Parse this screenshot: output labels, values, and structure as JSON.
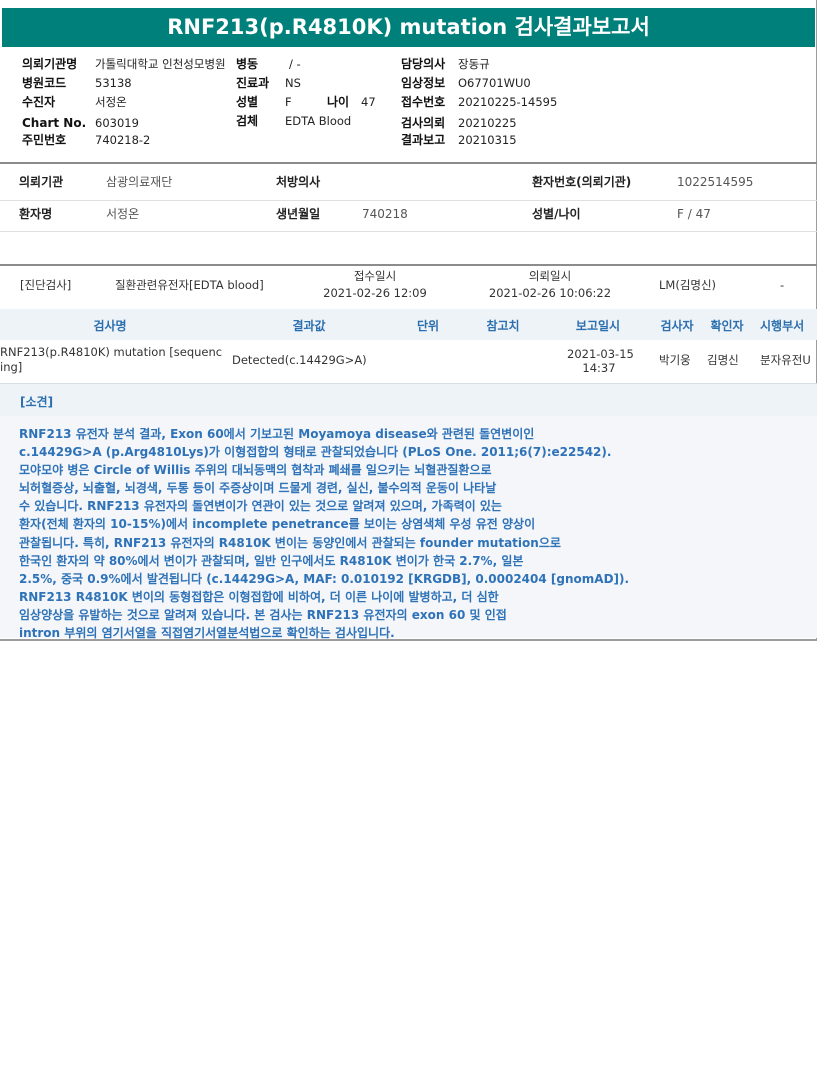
{
  "title": "RNF213(p.R4810K) mutation 검사결과보고서",
  "header": {
    "col1": [
      {
        "label": "의뢰기관명",
        "value": "가톨릭대학교 인천성모병원"
      },
      {
        "label": "병원코드",
        "value": "53138"
      },
      {
        "label": "수진자",
        "value": "서정온"
      },
      {
        "label": "Chart No.",
        "value": "603019"
      },
      {
        "label": "주민번호",
        "value": "740218-2"
      }
    ],
    "col2": [
      {
        "label": "병동",
        "value": "/ -"
      },
      {
        "label": "진료과",
        "value": "NS"
      },
      {
        "label": "성별",
        "value": "F"
      },
      {
        "label": "검체",
        "value": "EDTA Blood"
      }
    ],
    "age": {
      "label": "나이",
      "value": "47"
    },
    "col3": [
      {
        "label": "담당의사",
        "value": "장동규"
      },
      {
        "label": "임상정보",
        "value": "O67701WU0"
      },
      {
        "label": "접수번호",
        "value": "20210225-14595"
      },
      {
        "label": "검사의뢰",
        "value": "20210225"
      },
      {
        "label": "결과보고",
        "value": "20210315"
      }
    ]
  },
  "info": {
    "row1": [
      {
        "label": "의뢰기관",
        "value": "삼광의료재단"
      },
      {
        "label": "처방의사",
        "value": ""
      },
      {
        "label": "환자번호(의뢰기관)",
        "value": "1022514595"
      }
    ],
    "row2": [
      {
        "label": "환자명",
        "value": "서정온"
      },
      {
        "label": "생년월일",
        "value": "740218"
      },
      {
        "label": "성별/나이",
        "value": "F / 47"
      }
    ]
  },
  "test": {
    "category": "[진단검사]",
    "name": "질환관련유전자[EDTA blood]",
    "received_label": "접수일시",
    "received_value": "2021-02-26 12:09",
    "requested_label": "의뢰일시",
    "requested_value": "2021-02-26 10:06:22",
    "lab": "LM(김명신)",
    "dash": "-"
  },
  "results": {
    "columns": [
      "검사명",
      "결과값",
      "단위",
      "참고치",
      "보고일시",
      "검사자",
      "확인자",
      "시행부서"
    ],
    "row": {
      "name_line1": "RNF213(p.R4810K) mutation [sequenc",
      "name_line2": "ing]",
      "value": "Detected(c.14429G>A)",
      "unit": "",
      "ref": "",
      "date": "2021-03-15",
      "time": "14:37",
      "tester": "박기웅",
      "confirmer": "김명신",
      "dept": "분자유전U"
    }
  },
  "findings": {
    "label": "[소견]",
    "lines": [
      "RNF213 유전자 분석 결과, Exon 60에서 기보고된 Moyamoya disease와 관련된 돌연변이인",
      "c.14429G>A (p.Arg4810Lys)가 이형접합의 형태로 관찰되었습니다 (PLoS One. 2011;6(7):e22542).",
      "모야모야 병은 Circle of Willis 주위의 대뇌동맥의 협착과 폐쇄를 일으키는 뇌혈관질환으로",
      "뇌허혈증상, 뇌출혈, 뇌경색, 두통 등이 주증상이며 드물게 경련, 실신, 불수의적 운동이 나타날",
      "수 있습니다. RNF213 유전자의 돌연변이가 연관이 있는 것으로 알려져 있으며, 가족력이 있는",
      "환자(전체 환자의 10-15%)에서 incomplete penetrance를 보이는 상염색체 우성 유전 양상이",
      "관찰됩니다. 특히, RNF213 유전자의 R4810K 변이는 동양인에서 관찰되는 founder mutation으로",
      "한국인 환자의 약 80%에서 변이가 관찰되며, 일반 인구에서도 R4810K 변이가 한국 2.7%, 일본",
      "2.5%, 중국 0.9%에서 발견됩니다 (c.14429G>A, MAF: 0.010192 [KRGDB], 0.0002404 [gnomAD]).",
      "RNF213 R4810K 변이의 동형접합은 이형접합에 비하여, 더 이른 나이에 발병하고, 더 심한",
      "임상양상을 유발하는 것으로 알려져 있습니다. 본 검사는 RNF213 유전자의 exon 60 및 인접",
      "intron 부위의 염기서열을 직접염기서열분석법으로 확인하는 검사입니다."
    ]
  }
}
